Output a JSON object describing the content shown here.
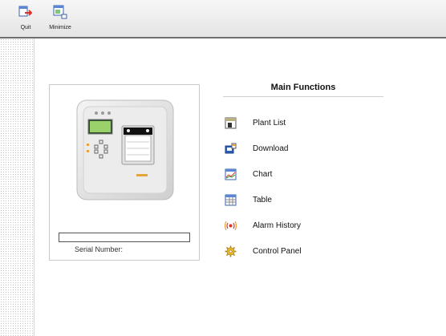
{
  "toolbar": {
    "quit": {
      "label": "Quit",
      "icon": "quit-icon"
    },
    "minimize": {
      "label": "Minimize",
      "icon": "minimize-icon"
    }
  },
  "device": {
    "image": "recorder-device-image",
    "serial_value": "",
    "serial_label": "Serial Number:"
  },
  "main": {
    "title": "Main Functions",
    "functions": [
      {
        "label": "Plant List",
        "icon": "plant-list-icon"
      },
      {
        "label": "Download",
        "icon": "download-icon"
      },
      {
        "label": "Chart",
        "icon": "chart-icon"
      },
      {
        "label": "Table",
        "icon": "table-icon"
      },
      {
        "label": "Alarm History",
        "icon": "alarm-history-icon"
      },
      {
        "label": "Control Panel",
        "icon": "control-panel-icon"
      }
    ]
  },
  "colors": {
    "accent_orange": "#e8a23a",
    "alarm_red": "#d8342a",
    "toolbar_border": "#6f6f6f"
  }
}
